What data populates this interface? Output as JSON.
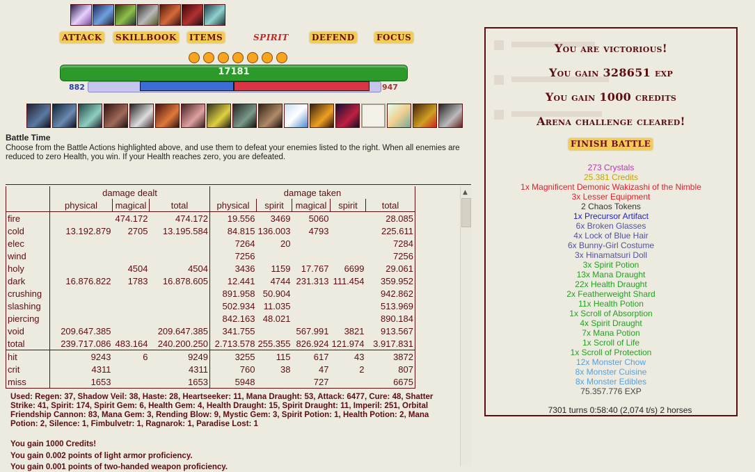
{
  "menu": {
    "attack": "ATTACK",
    "skillbook": "SKILLBOOK",
    "items": "ITEMS",
    "spirit": "SPIRIT",
    "defend": "DEFEND",
    "focus": "FOCUS"
  },
  "effects_icons": [
    "effect-icon",
    "effect-icon",
    "effect-icon",
    "effect-icon",
    "effect-icon",
    "effect-icon",
    "effect-icon"
  ],
  "charge_orbs": 7,
  "health": {
    "value": "17181",
    "fraction": 1.0,
    "color": "#2b9a2b"
  },
  "mana": {
    "left": "882",
    "right": "947"
  },
  "skill_slots": 16,
  "battle": {
    "title": "Battle Time",
    "text": "Choose from the Battle Actions highlighted above, and use them to defeat your enemies listed to the right. When all enemies are reduced to zero Health, you win. If your Health reaches zero, you are defeated."
  },
  "table": {
    "group_dealt": "damage dealt",
    "group_taken": "damage taken",
    "cols": [
      "physical",
      "magical",
      "total",
      "physical",
      "spirit",
      "magical",
      "spirit",
      "total"
    ],
    "rows": [
      [
        "fire",
        "",
        "474.172",
        "474.172",
        "19.556",
        "3469",
        "5060",
        "",
        "28.085"
      ],
      [
        "cold",
        "13.192.879",
        "2705",
        "13.195.584",
        "84.815",
        "136.003",
        "4793",
        "",
        "225.611"
      ],
      [
        "elec",
        "",
        "",
        "",
        "7264",
        "20",
        "",
        "",
        "7284"
      ],
      [
        "wind",
        "",
        "",
        "",
        "7256",
        "",
        "",
        "",
        "7256"
      ],
      [
        "holy",
        "",
        "4504",
        "4504",
        "3436",
        "1159",
        "17.767",
        "6699",
        "29.061"
      ],
      [
        "dark",
        "16.876.822",
        "1783",
        "16.878.605",
        "12.441",
        "4744",
        "231.313",
        "111.454",
        "359.952"
      ],
      [
        "crushing",
        "",
        "",
        "",
        "891.958",
        "50.904",
        "",
        "",
        "942.862"
      ],
      [
        "slashing",
        "",
        "",
        "",
        "502.934",
        "11.035",
        "",
        "",
        "513.969"
      ],
      [
        "piercing",
        "",
        "",
        "",
        "842.163",
        "48.021",
        "",
        "",
        "890.184"
      ],
      [
        "void",
        "209.647.385",
        "",
        "209.647.385",
        "341.755",
        "",
        "567.991",
        "3821",
        "913.567"
      ],
      [
        "total",
        "239.717.086",
        "483.164",
        "240.200.250",
        "2.713.578",
        "255.355",
        "826.924",
        "121.974",
        "3.917.831"
      ]
    ],
    "stats": [
      [
        "hit",
        "9243",
        "6",
        "9249",
        "3255",
        "115",
        "617",
        "43",
        "3872"
      ],
      [
        "crit",
        "4311",
        "",
        "4311",
        "760",
        "38",
        "47",
        "2",
        "807"
      ],
      [
        "miss",
        "1653",
        "",
        "1653",
        "5948",
        "",
        "727",
        "",
        "6675"
      ]
    ]
  },
  "log": {
    "used": "Used: Regen: 37, Shadow Veil: 38, Haste: 28, Heartseeker: 11, Mana Draught: 53, Attack: 6477, Cure: 48, Shatter Strike: 41, Spirit: 174, Spirit Gem: 6, Health Gem: 4, Health Draught: 15, Spirit Draught: 11, Imperil: 251, Orbital Friendship Cannon: 83, Mana Gem: 3, Rending Blow: 9, Mystic Gem: 3, Spirit Potion: 1, Health Potion: 2, Mana Potion: 2, Silence: 1, Fimbulvetr: 1, Ragnarok: 1, Paradise Lost: 1",
    "credits": "You gain 1000 Credits!",
    "proficiency": "You gain 0.002 points of light armor proficiency.",
    "partial": "You gain 0.001 points of two-handed weapon proficiency."
  },
  "result": {
    "victory": "You are victorious!",
    "exp": "You gain 328651 exp",
    "credits": "You gain 1000 credits",
    "arena": "Arena challenge cleared!",
    "finish": "FINISH BATTLE"
  },
  "drops": [
    {
      "text": "273 Crystals",
      "color": "#c02fc0"
    },
    {
      "text": "25.381 Credits",
      "color": "#c5a400"
    },
    {
      "text": "1x Magnificent Demonic Wakizashi of the Nimble",
      "color": "#e0202a"
    },
    {
      "text": "3x Lesser Equipment",
      "color": "#e0202a"
    },
    {
      "text": "2 Chaos Tokens",
      "color": "#333333"
    },
    {
      "text": "1x Precursor Artifact",
      "color": "#2020d0"
    },
    {
      "text": "6x Broken Glasses",
      "color": "#5050a0"
    },
    {
      "text": "4x Lock of Blue Hair",
      "color": "#5050a0"
    },
    {
      "text": "6x Bunny-Girl Costume",
      "color": "#5050a0"
    },
    {
      "text": "3x Hinamatsuri Doll",
      "color": "#5050a0"
    },
    {
      "text": "3x Spirit Potion",
      "color": "#22a022"
    },
    {
      "text": "13x Mana Draught",
      "color": "#22a022"
    },
    {
      "text": "22x Health Draught",
      "color": "#22a022"
    },
    {
      "text": "2x Featherweight Shard",
      "color": "#22a022"
    },
    {
      "text": "11x Health Potion",
      "color": "#22a022"
    },
    {
      "text": "1x Scroll of Absorption",
      "color": "#22a022"
    },
    {
      "text": "4x Spirit Draught",
      "color": "#22a022"
    },
    {
      "text": "7x Mana Potion",
      "color": "#22a022"
    },
    {
      "text": "1x Scroll of Life",
      "color": "#22a022"
    },
    {
      "text": "1x Scroll of Protection",
      "color": "#22a022"
    },
    {
      "text": "12x Monster Chow",
      "color": "#55a0e0"
    },
    {
      "text": "8x Monster Cuisine",
      "color": "#55a0e0"
    },
    {
      "text": "8x Monster Edibles",
      "color": "#55a0e0"
    },
    {
      "text": "75.357.776 EXP",
      "color": "#444444"
    }
  ],
  "footer": "7301 turns 0:58:40 (2,074 t/s) 2 horses"
}
